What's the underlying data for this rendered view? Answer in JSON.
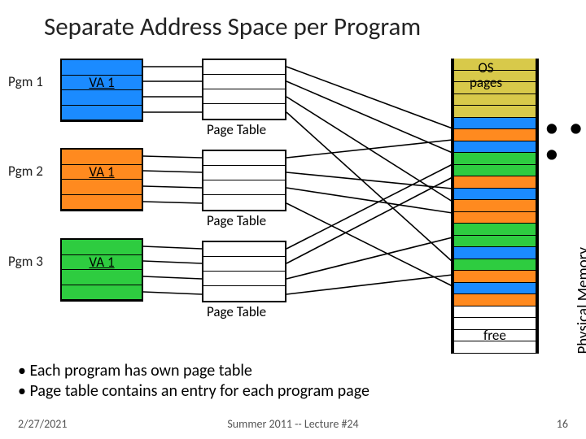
{
  "title": "Separate Address Space per Program",
  "programs": [
    {
      "label": "Pgm 1",
      "va": "VA 1",
      "page_table_label": "Page Table"
    },
    {
      "label": "Pgm 2",
      "va": "VA 1",
      "page_table_label": "Page Table"
    },
    {
      "label": "Pgm 3",
      "va": "VA 1",
      "page_table_label": "Page Table"
    }
  ],
  "physical_memory": {
    "label": "Physical Memory",
    "os_label": "OS\npages",
    "ellipsis": "●  ●  ●",
    "free_label": "free"
  },
  "bullets": [
    "Each program has own page table",
    "Page table contains an entry for each program page"
  ],
  "footer": {
    "date": "2/27/2021",
    "center": "Summer 2011 -- Lecture #24",
    "page": "16"
  }
}
